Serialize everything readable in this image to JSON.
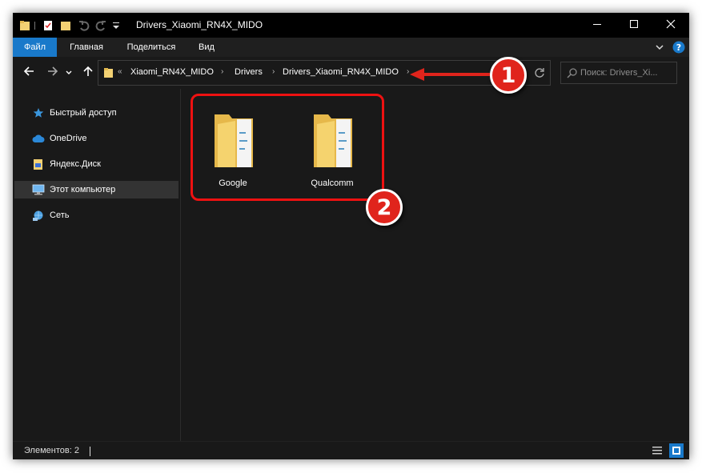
{
  "window": {
    "title": "Drivers_Xiaomi_RN4X_MIDO"
  },
  "ribbon": {
    "tabs": [
      {
        "label": "Файл",
        "active": true
      },
      {
        "label": "Главная"
      },
      {
        "label": "Поделиться"
      },
      {
        "label": "Вид"
      }
    ]
  },
  "address": {
    "prefix": "«",
    "crumbs": [
      "Xiaomi_RN4X_MIDO",
      "Drivers",
      "Drivers_Xiaomi_RN4X_MIDO"
    ]
  },
  "search": {
    "placeholder": "Поиск: Drivers_Xi..."
  },
  "sidebar": {
    "items": [
      {
        "label": "Быстрый доступ",
        "icon": "star-icon"
      },
      {
        "label": "OneDrive",
        "icon": "cloud-icon"
      },
      {
        "label": "Яндекс.Диск",
        "icon": "yandex-disk-icon"
      },
      {
        "label": "Этот компьютер",
        "icon": "computer-icon",
        "selected": true
      },
      {
        "label": "Сеть",
        "icon": "network-icon"
      }
    ]
  },
  "folders": [
    {
      "label": "Google"
    },
    {
      "label": "Qualcomm"
    }
  ],
  "status": {
    "count": "Элементов: 2"
  },
  "annotations": {
    "badge1": "1",
    "badge2": "2"
  },
  "colors": {
    "accent": "#1979ca",
    "annotation_red": "#e0241c",
    "folder_yellow": "#f5d36e"
  }
}
